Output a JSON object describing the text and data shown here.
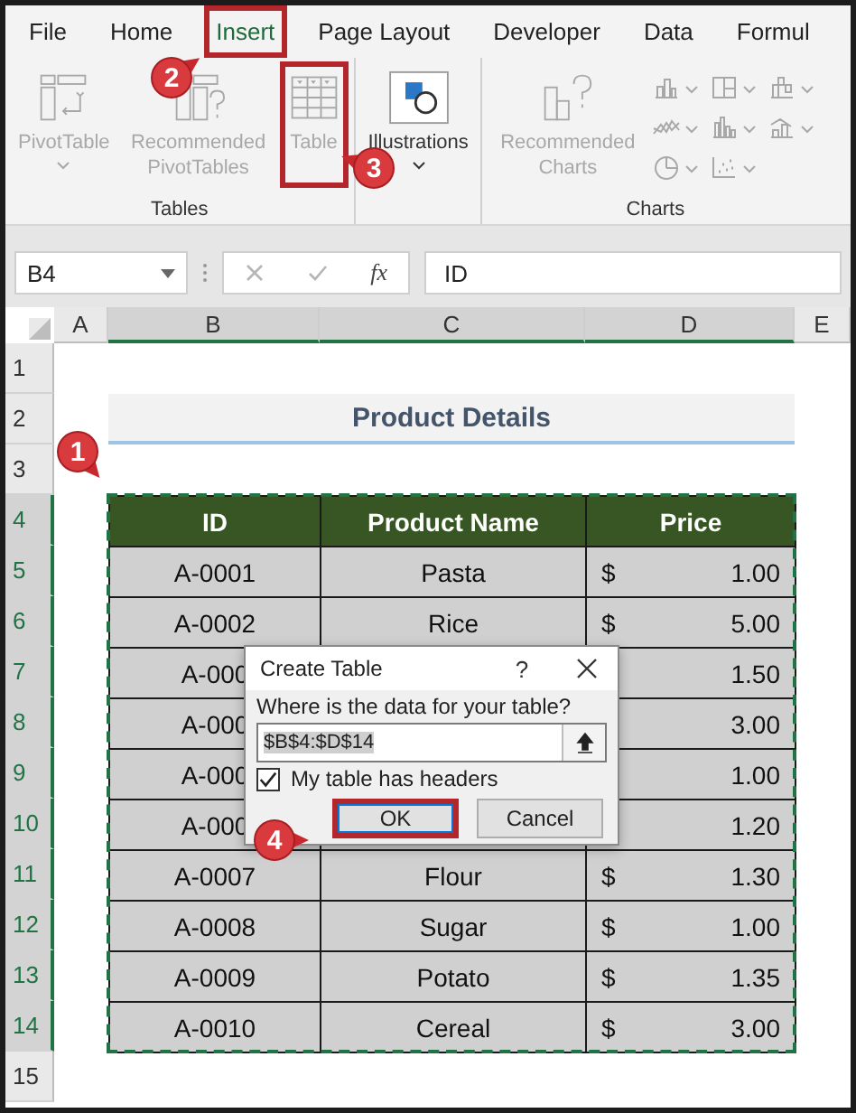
{
  "ribbon_tabs": [
    {
      "label": "File",
      "selected": false,
      "highlighted": false
    },
    {
      "label": "Home",
      "selected": false,
      "highlighted": false
    },
    {
      "label": "Insert",
      "selected": true,
      "highlighted": true
    },
    {
      "label": "Page Layout",
      "selected": false,
      "highlighted": false
    },
    {
      "label": "Developer",
      "selected": false,
      "highlighted": false
    },
    {
      "label": "Data",
      "selected": false,
      "highlighted": false
    },
    {
      "label": "Formul",
      "selected": false,
      "highlighted": false
    }
  ],
  "ribbon_groups": [
    {
      "label": "Tables",
      "commands": [
        {
          "kind": "pivot_table",
          "label": "PivotTable",
          "disabled": true,
          "dropdown": true,
          "highlighted": false
        },
        {
          "kind": "recommended_pivot",
          "label": "Recommended PivotTables",
          "disabled": true,
          "dropdown": false,
          "highlighted": false
        },
        {
          "kind": "table",
          "label": "Table",
          "disabled": true,
          "dropdown": false,
          "highlighted": true
        }
      ]
    },
    {
      "commands": [
        {
          "kind": "illustrations",
          "label": "Illustrations",
          "disabled": false,
          "dropdown": true,
          "highlighted": false
        }
      ]
    },
    {
      "label": "Charts",
      "commands": [
        {
          "kind": "recommended_charts",
          "label": "Recommended Charts",
          "disabled": true,
          "dropdown": false,
          "highlighted": false
        }
      ],
      "chart_buttons": [
        {
          "kind": "column",
          "disabled": true
        },
        {
          "kind": "treemap",
          "disabled": true
        },
        {
          "kind": "waterfall",
          "disabled": true
        },
        {
          "kind": "line",
          "disabled": true
        },
        {
          "kind": "histogram",
          "disabled": true
        },
        {
          "kind": "combo",
          "disabled": true
        },
        {
          "kind": "pie",
          "disabled": true
        },
        {
          "kind": "scatter",
          "disabled": true
        }
      ]
    }
  ],
  "formula_bar": {
    "name_box": "B4",
    "insert_function": "fx",
    "formula": "ID"
  },
  "columns": [
    {
      "label": "A",
      "selected": false
    },
    {
      "label": "B",
      "selected": true
    },
    {
      "label": "C",
      "selected": true
    },
    {
      "label": "D",
      "selected": true
    },
    {
      "label": "E",
      "selected": false
    }
  ],
  "rows": [
    {
      "label": "1",
      "selected": false
    },
    {
      "label": "2",
      "selected": false
    },
    {
      "label": "3",
      "selected": false
    },
    {
      "label": "4",
      "selected": true
    },
    {
      "label": "5",
      "selected": true
    },
    {
      "label": "6",
      "selected": true
    },
    {
      "label": "7",
      "selected": true
    },
    {
      "label": "8",
      "selected": true
    },
    {
      "label": "9",
      "selected": true
    },
    {
      "label": "10",
      "selected": true
    },
    {
      "label": "11",
      "selected": true
    },
    {
      "label": "12",
      "selected": true
    },
    {
      "label": "13",
      "selected": true
    },
    {
      "label": "14",
      "selected": true
    },
    {
      "label": "15",
      "selected": false
    }
  ],
  "sheet_title": "Product Details",
  "table": {
    "columns": [
      "ID",
      "Product Name",
      "Price"
    ],
    "rows": [
      {
        "id": "A-0001",
        "product": "Pasta",
        "currency": "$",
        "price": "1.00"
      },
      {
        "id": "A-0002",
        "product": "Rice",
        "currency": "$",
        "price": "5.00"
      },
      {
        "id": "A-000",
        "price": "1.50"
      },
      {
        "id": "A-000",
        "price": "3.00"
      },
      {
        "id": "A-000",
        "price": "1.00"
      },
      {
        "id": "A-000",
        "price": "1.20"
      },
      {
        "id": "A-0007",
        "product": "Flour",
        "currency": "$",
        "price": "1.30"
      },
      {
        "id": "A-0008",
        "product": "Sugar",
        "currency": "$",
        "price": "1.00"
      },
      {
        "id": "A-0009",
        "product": "Potato",
        "currency": "$",
        "price": "1.35"
      },
      {
        "id": "A-0010",
        "product": "Cereal",
        "currency": "$",
        "price": "3.00"
      }
    ]
  },
  "dialog": {
    "title": "Create Table",
    "help": "?",
    "prompt": "Where is the data for your table?",
    "range": "$B$4:$D$14",
    "headers_checkbox": {
      "label": "My table has headers",
      "checked": true
    },
    "buttons": [
      {
        "label": "OK",
        "default": true,
        "highlighted": true
      },
      {
        "label": "Cancel",
        "default": false,
        "highlighted": false
      }
    ]
  },
  "callouts": [
    {
      "label": "1"
    },
    {
      "label": "2"
    },
    {
      "label": "3"
    },
    {
      "label": "4"
    }
  ]
}
